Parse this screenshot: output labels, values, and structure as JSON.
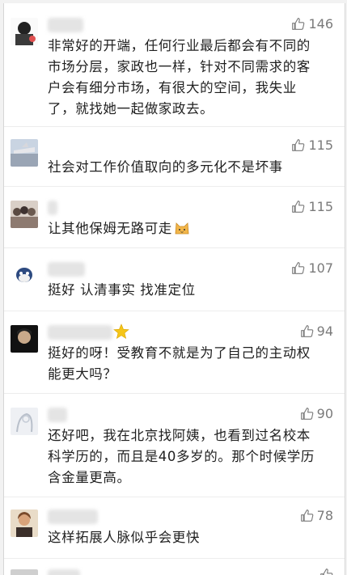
{
  "colors": {
    "text": "#1f1f1f",
    "meta": "#7a7a7a",
    "separator": "#ededed"
  },
  "comments": [
    {
      "likes": "146",
      "lines": [
        "非常好的开端，任何行业最后都会有不同的",
        "市场分层，家政也一样，针对不同需求的客",
        "户会有细分市场，有很大的空间，我失业",
        "了，就找她一起做家政去。"
      ]
    },
    {
      "likes": "115",
      "lines": [
        "社会对工作价值取向的多元化不是坏事"
      ]
    },
    {
      "likes": "115",
      "lines": [
        "让其他保姆无路可走"
      ]
    },
    {
      "likes": "107",
      "lines": [
        "挺好 认清事实 找准定位"
      ]
    },
    {
      "likes": "94",
      "lines": [
        "挺好的呀！受教育不就是为了自己的主动权",
        "能更大吗？"
      ]
    },
    {
      "likes": "90",
      "lines": [
        "还好吧，我在北京找阿姨，也看到过名校本",
        "科学历的，而且是40多岁的。那个时候学历",
        "含金量更高。"
      ]
    },
    {
      "likes": "78",
      "lines": [
        "这样拓展人脉似乎会更快"
      ]
    }
  ],
  "icons": {
    "like": "thumb-up-icon",
    "emoji": "cat-emoji-icon",
    "badge": "star-icon"
  }
}
